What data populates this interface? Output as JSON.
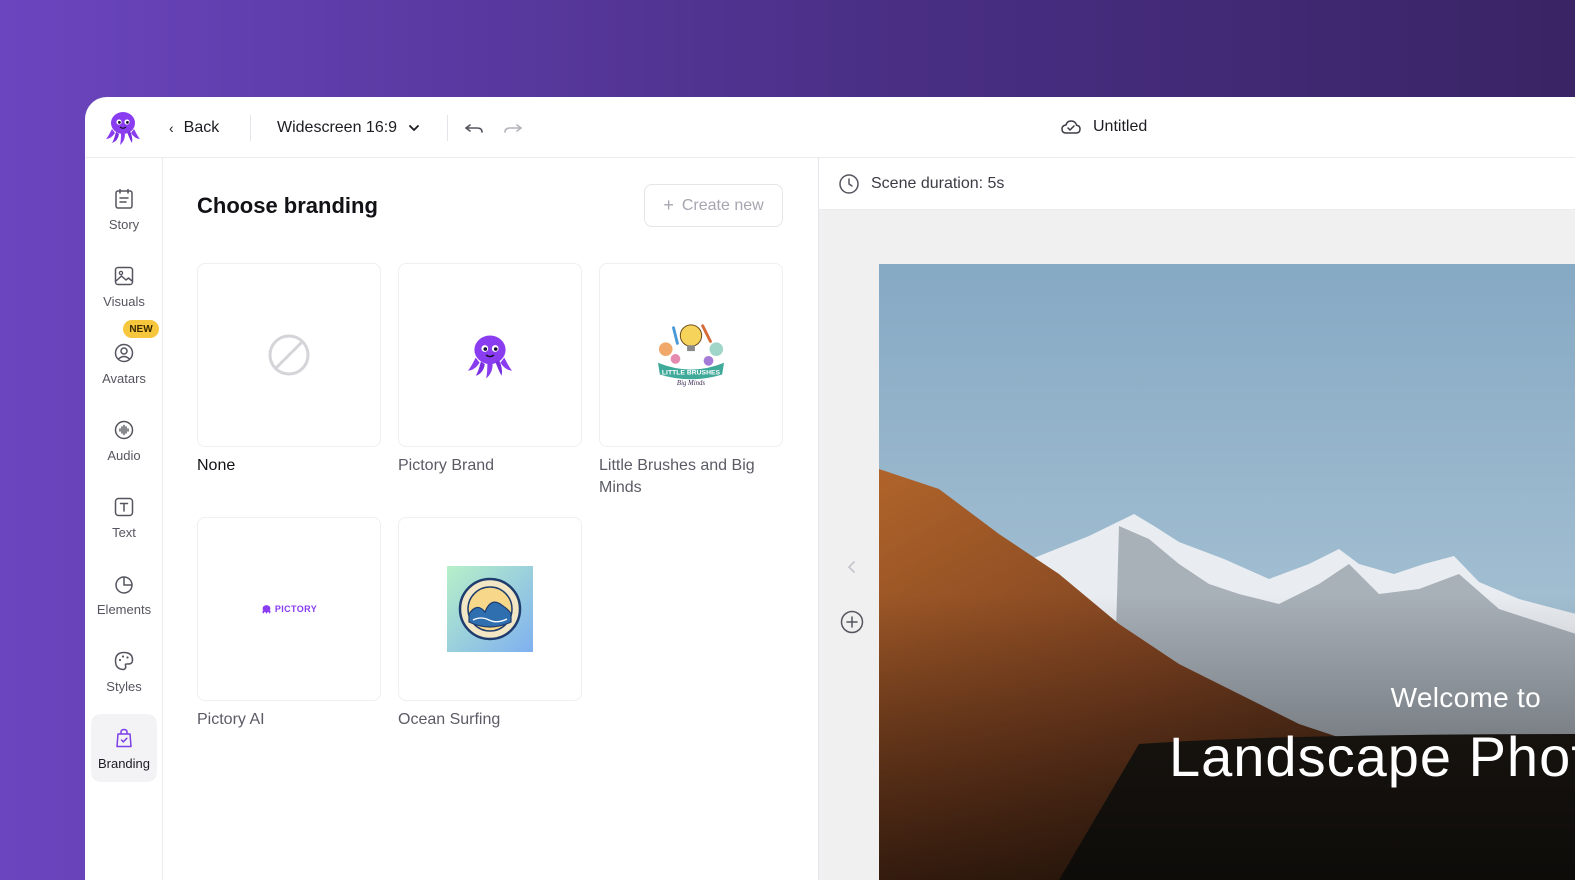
{
  "header": {
    "back_label": "Back",
    "ratio_label": "Widescreen 16:9",
    "project_title": "Untitled",
    "icons": [
      "octopus-logo",
      "chevron-left-icon",
      "chevron-down-icon",
      "undo-icon",
      "redo-icon",
      "cloud-icon"
    ]
  },
  "sidebar": {
    "items": [
      {
        "label": "Story",
        "icon": "story-icon"
      },
      {
        "label": "Visuals",
        "icon": "image-icon"
      },
      {
        "label": "Avatars",
        "icon": "avatar-icon",
        "badge": "NEW"
      },
      {
        "label": "Audio",
        "icon": "audio-icon"
      },
      {
        "label": "Text",
        "icon": "text-icon"
      },
      {
        "label": "Elements",
        "icon": "elements-icon"
      },
      {
        "label": "Styles",
        "icon": "palette-icon"
      },
      {
        "label": "Branding",
        "icon": "branding-icon",
        "active": true
      }
    ]
  },
  "branding": {
    "title": "Choose branding",
    "create_label": "Create new",
    "cards": [
      {
        "label": "None",
        "selected": true
      },
      {
        "label": "Pictory Brand"
      },
      {
        "label": "Little Brushes and Big Minds",
        "logo_text": [
          "LITTLE BRUSHES",
          "Big Minds"
        ]
      },
      {
        "label": "Pictory AI",
        "logo_text": "PICTORY"
      },
      {
        "label": "Ocean Surfing"
      }
    ]
  },
  "preview": {
    "scene_duration": "Scene duration: 5s",
    "welcome_text": "Welcome to",
    "headline_text": "Landscape Phot"
  },
  "colors": {
    "brand_purple": "#7b3fe4",
    "badge_yellow": "#f6c63d",
    "background_gradient": [
      "#6b45bf",
      "#3a2465"
    ]
  }
}
